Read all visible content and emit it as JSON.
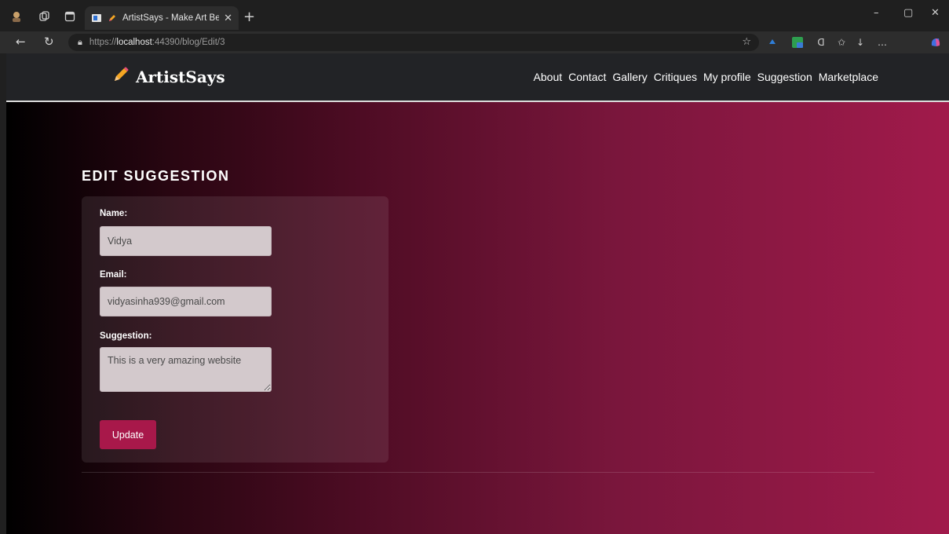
{
  "browser": {
    "tab_title": "ArtistSays - Make Art Better",
    "url_prefix": "https://",
    "url_host": "localhost",
    "url_rest": ":44390/blog/Edit/3"
  },
  "site": {
    "brand": "ArtistSays",
    "nav": [
      "About",
      "Contact",
      "Gallery",
      "Critiques",
      "My profile",
      "Suggestion",
      "Marketplace"
    ]
  },
  "form": {
    "heading": "EDIT SUGGESTION",
    "name_label": "Name:",
    "name_value": "Vidya",
    "email_label": "Email:",
    "email_value": "vidyasinha939@gmail.com",
    "suggestion_label": "Suggestion:",
    "suggestion_value": "This is a very amazing website",
    "submit_label": "Update"
  },
  "colors": {
    "accent": "#a8184a",
    "navbar_bg": "#222326"
  }
}
